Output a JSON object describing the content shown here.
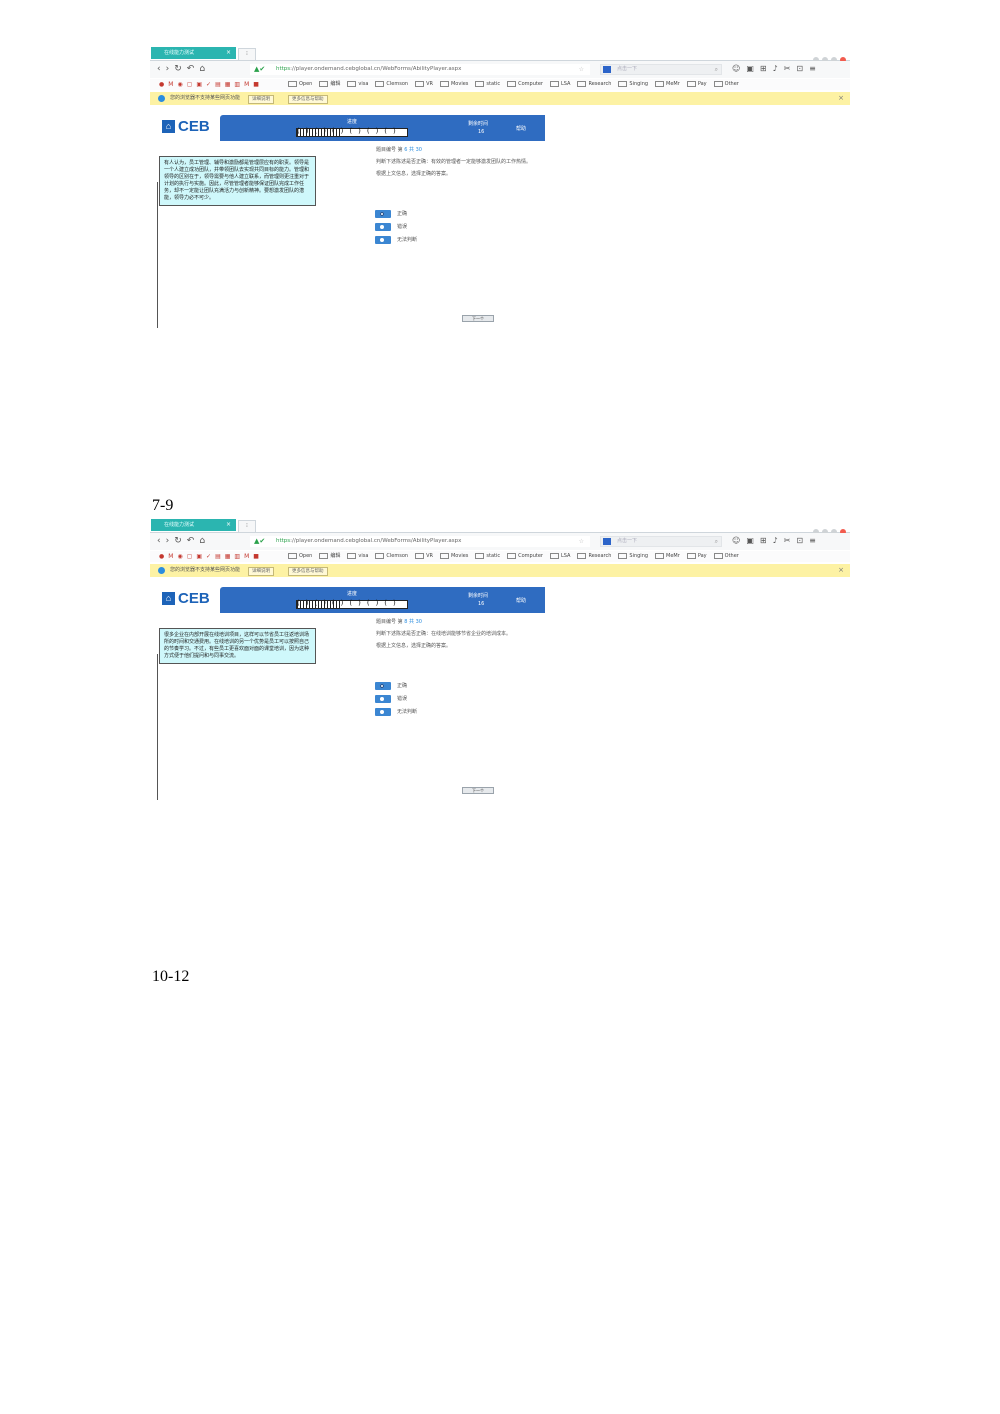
{
  "browser": {
    "tab_title": "在线能力测试",
    "tab_close": "×",
    "new_tab": "⁝",
    "url_scheme": "https",
    "url_rest": "://player.ondemand.cebglobal.cn/WebForms/AbilityPlayer.aspx",
    "search_placeholder": "点击一下",
    "bookmarks": [
      "Open",
      "编辑",
      "visa",
      "Clemson",
      "VR",
      "Movies",
      "static",
      "Computer",
      "LSA",
      "Research",
      "Singing",
      "MeMr",
      "Pay",
      "Other"
    ],
    "notice_text": "您的浏览器不支持某些网页功能",
    "notice_btn_1": "详细说明",
    "notice_btn_2": "更多信息与帮助",
    "notice_close": "×"
  },
  "test": {
    "logo_text": "CEB",
    "progress_label": "进度",
    "progress_fraction": 0.4,
    "time_label": "剩余时间",
    "time_value": "16",
    "help_label": "帮助",
    "question_number_prefix": "题目编号 第",
    "question_number_value": "6",
    "question_total_prefix": "共",
    "question_total_value": "30",
    "statement_prompt": "判断下述陈述是否正确：",
    "instruction": "根据上文信息，选择正确的答案。",
    "options": [
      "正确",
      "错误",
      "无法判断"
    ],
    "next_label": "下一个"
  },
  "pages": [
    {
      "label": "",
      "question_text": "有人认为，员工管理、辅导和激励都是管理层应有的职责。领导是一个人建立成功团队，并带领团队去实现共同目标的能力。管理和领导的区别在于，领导需要与他人建立联系，而管理则更注重对于计划的执行与实施。因此，尽管管理者能够保证团队完成工作任务，却不一定能让团队充满活力与创新精神。要想激发团队的潜能，领导力必不可少。",
      "question_no": "6",
      "statement": "有效的管理者一定能够激发团队的工作热情。"
    },
    {
      "label": "7-9",
      "question_text": "很多企业在内部开展在线培训项目，这样可以节省员工往返培训场所的时间和交通费用。在线培训的另一个优势是员工可以按照自己的节奏学习。不过，有些员工更喜欢面对面的课堂培训，因为这种方式便于他们提问和与同事交流。",
      "question_no": "8",
      "statement": "在线培训能够节省企业的培训成本。"
    }
  ],
  "footer_label": "10-12"
}
